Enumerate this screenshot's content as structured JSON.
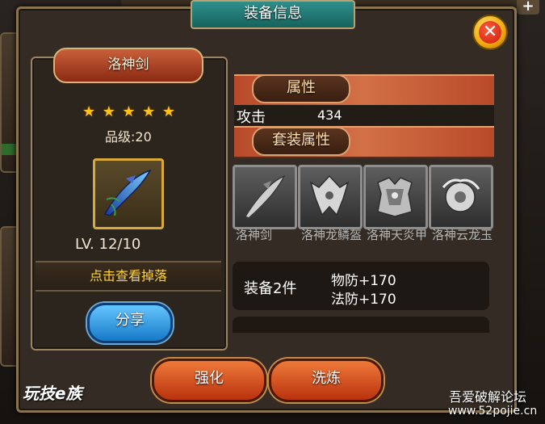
{
  "dialog": {
    "title": "装备信息"
  },
  "item": {
    "name": "洛神剑",
    "stars": 5,
    "quality_text": "品级:20",
    "level_text": "LV. 12/10",
    "drop_link": "点击查看掉落",
    "share_label": "分享"
  },
  "attributes": {
    "section_title": "属性",
    "stats": [
      {
        "label": "攻击",
        "value": "434"
      }
    ]
  },
  "set_bonus": {
    "section_title": "套装属性",
    "items": [
      {
        "name": "洛神剑",
        "icon": "sword-icon"
      },
      {
        "name": "洛神龙鳞盔",
        "icon": "helmet-icon"
      },
      {
        "name": "洛神天炎甲",
        "icon": "armor-icon"
      },
      {
        "name": "洛神云龙玉",
        "icon": "jade-pendant-icon"
      }
    ],
    "tiers": [
      {
        "label": "装备2件",
        "lines": [
          "物防+170",
          "法防+170"
        ]
      }
    ]
  },
  "actions": {
    "enhance_label": "强化",
    "refine_label": "洗炼"
  },
  "watermarks": {
    "left": "玩技e族",
    "right": "吾爱破解论坛",
    "url": "www.52pojie.cn"
  },
  "colors": {
    "gold_star": "#ffc21a",
    "drop_link": "#ffd23a",
    "section_bar": "#c95a34"
  }
}
